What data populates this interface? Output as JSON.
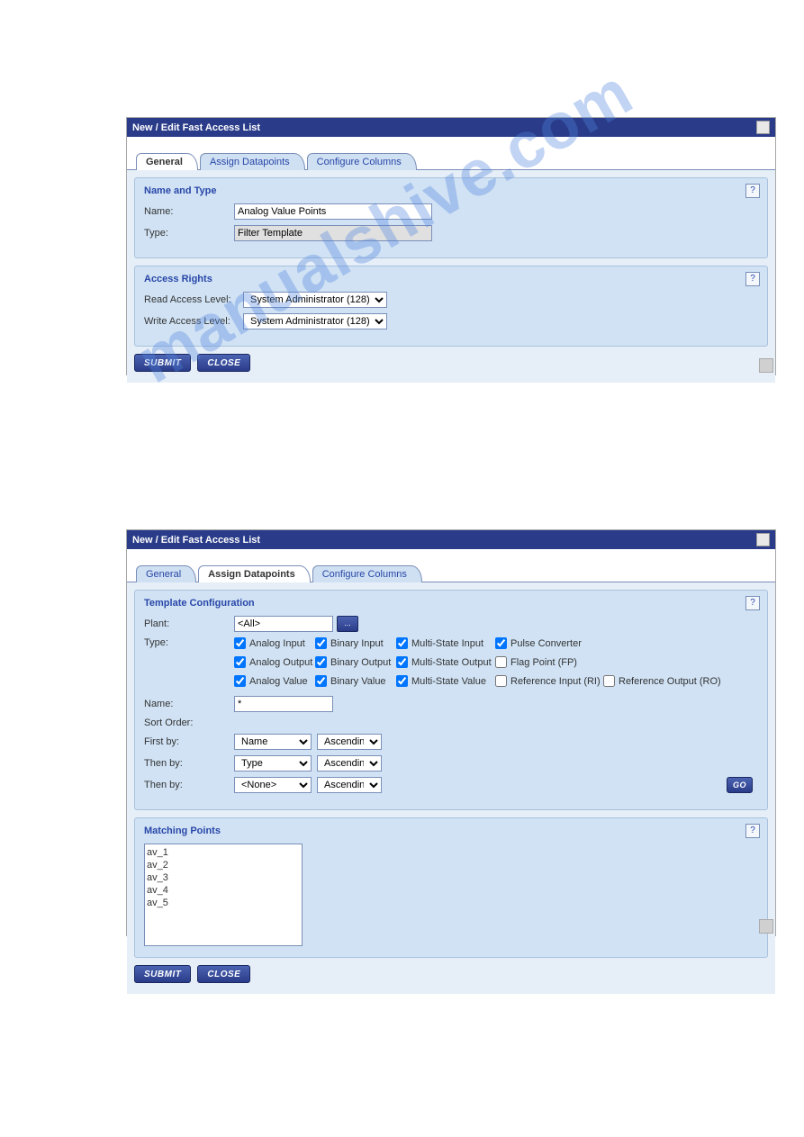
{
  "watermark": "manualshive.com",
  "dialog1": {
    "title": "New / Edit Fast Access List",
    "tabs": [
      "General",
      "Assign Datapoints",
      "Configure Columns"
    ],
    "activeTab": 0,
    "nameType": {
      "title": "Name and Type",
      "name_label": "Name:",
      "name_value": "Analog Value Points",
      "type_label": "Type:",
      "type_value": "Filter Template"
    },
    "access": {
      "title": "Access Rights",
      "read_label": "Read Access Level:",
      "read_value": "System Administrator (128)",
      "write_label": "Write Access Level:",
      "write_value": "System Administrator (128)"
    },
    "buttons": {
      "submit": "SUBMIT",
      "close": "CLOSE"
    }
  },
  "dialog2": {
    "title": "New / Edit Fast Access List",
    "tabs": [
      "General",
      "Assign Datapoints",
      "Configure Columns"
    ],
    "activeTab": 1,
    "template": {
      "title": "Template Configuration",
      "plant_label": "Plant:",
      "plant_value": "<All>",
      "type_label": "Type:",
      "types": [
        {
          "label": "Analog Input",
          "checked": true
        },
        {
          "label": "Binary Input",
          "checked": true
        },
        {
          "label": "Multi-State Input",
          "checked": true
        },
        {
          "label": "Pulse Converter",
          "checked": true
        },
        {
          "label": "",
          "checked": null
        },
        {
          "label": "Analog Output",
          "checked": true
        },
        {
          "label": "Binary Output",
          "checked": true
        },
        {
          "label": "Multi-State Output",
          "checked": true
        },
        {
          "label": "Flag Point (FP)",
          "checked": false
        },
        {
          "label": "",
          "checked": null
        },
        {
          "label": "Analog Value",
          "checked": true
        },
        {
          "label": "Binary Value",
          "checked": true
        },
        {
          "label": "Multi-State Value",
          "checked": true
        },
        {
          "label": "Reference Input (RI)",
          "checked": false
        },
        {
          "label": "Reference Output (RO)",
          "checked": false
        }
      ],
      "name_label": "Name:",
      "name_value": "*",
      "sort_label": "Sort Order:",
      "first_by_label": "First by:",
      "first_by_field": "Name",
      "first_by_order": "Ascending",
      "then_by1_label": "Then by:",
      "then_by1_field": "Type",
      "then_by1_order": "Ascending",
      "then_by2_label": "Then by:",
      "then_by2_field": "<None>",
      "then_by2_order": "Ascending",
      "go": "GO"
    },
    "matching": {
      "title": "Matching Points",
      "items": [
        "av_1",
        "av_2",
        "av_3",
        "av_4",
        "av_5"
      ]
    },
    "buttons": {
      "submit": "SUBMIT",
      "close": "CLOSE"
    }
  },
  "help_char": "?"
}
